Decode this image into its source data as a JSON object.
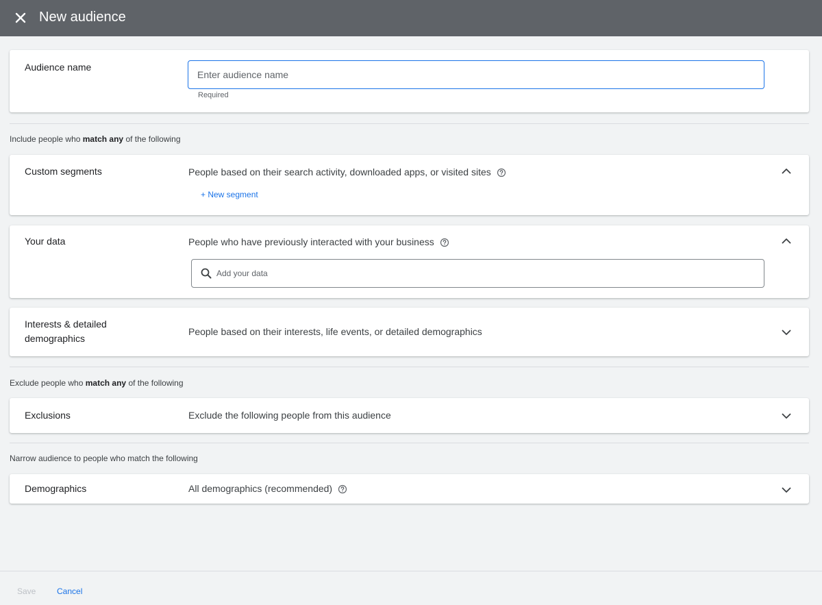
{
  "header": {
    "title": "New audience",
    "close_icon": "close-icon"
  },
  "audience_name": {
    "label": "Audience name",
    "placeholder": "Enter audience name",
    "value": "",
    "helper": "Required"
  },
  "include_section": {
    "caption_prefix": "Include people who ",
    "caption_bold": "match any",
    "caption_suffix": " of the following"
  },
  "custom_segments": {
    "label": "Custom segments",
    "description": "People based on their search activity, downloaded apps, or visited sites",
    "new_segment_link": "+ New segment",
    "expanded": true
  },
  "your_data": {
    "label": "Your data",
    "description": "People who have previously interacted with your business",
    "search_placeholder": "Add your data",
    "expanded": true
  },
  "interests": {
    "label_line1": "Interests & detailed",
    "label_line2": "demographics",
    "description": "People based on their interests, life events, or detailed demographics",
    "expanded": false
  },
  "exclude_section": {
    "caption_prefix": "Exclude people who ",
    "caption_bold": "match any",
    "caption_suffix": " of the following"
  },
  "exclusions": {
    "label": "Exclusions",
    "description": "Exclude the following people from this audience",
    "expanded": false
  },
  "narrow_section": {
    "caption": "Narrow audience to people who match the following"
  },
  "demographics": {
    "label": "Demographics",
    "description": "All demographics (recommended)",
    "expanded": false
  },
  "footer": {
    "save_label": "Save",
    "cancel_label": "Cancel"
  },
  "colors": {
    "header_bg": "#5f6368",
    "page_bg": "#f1f3f4",
    "accent": "#1a73e8",
    "disabled": "#bdc1c6"
  }
}
